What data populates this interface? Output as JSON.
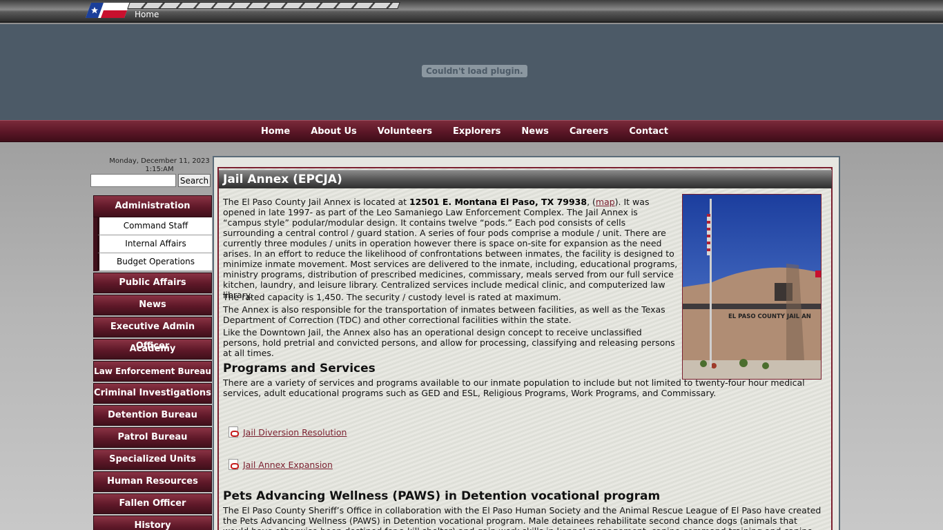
{
  "top_bar": {
    "home_label": "Home"
  },
  "plugin": {
    "message": "Couldn't load plugin."
  },
  "main_nav": [
    "Home",
    "About Us",
    "Volunteers",
    "Explorers",
    "News",
    "Careers",
    "Contact"
  ],
  "sidebar": {
    "date": "Monday, December 11, 2023",
    "time": "1:15:AM",
    "search_placeholder": "",
    "search_button": "Search",
    "active_section": "Administration",
    "sub_items": [
      "Command Staff",
      "Internal Affairs",
      "Budget Operations"
    ],
    "items": [
      "Public Affairs",
      "News",
      "Executive Admin Officer",
      "Academy",
      "Law Enforcement Bureau",
      "Criminal Investigations",
      "Detention Bureau",
      "Patrol Bureau",
      "Specialized Units",
      "Human Resources",
      "Fallen Officer",
      "History"
    ]
  },
  "content": {
    "title": "Jail Annex (EPCJA)",
    "p1_prefix": "The El Paso County Jail Annex is located at ",
    "p1_address": "12501 E. Montana El Paso, TX 79938",
    "p1_map_open": ", (",
    "p1_map": "map",
    "p1_rest": "). It was opened in late 1997- as part of the Leo Samaniego Law Enforcement Complex. The Jail Annex is “campus style” podular/modular design. It contains twelve “pods.” Each pod consists of cells surrounding a central control / guard station. A series of four pods comprise a module / unit. There are currently three modules / units in operation however there is space on-site for expansion as the need arises. In an effort to reduce the likelihood of confrontations between inmates, the facility is designed to minimize inmate movement. Most services are delivered to the inmate, including, educational programs, ministry programs, distribution of prescribed medicines, commissary, meals served from our full service kitchen, laundry, and leisure library. Centralized services include medical clinic, and computerized law library.",
    "p2": "The rated capacity is 1,450. The security / custody level is rated at maximum.",
    "p3": "The Annex is also responsible for the transportation of inmates between facilities, as well as the Texas Department of Correction (TDC) and other correctional facilities within the state.",
    "p4": "Like the Downtown Jail, the Annex also has an operational design concept to receive unclassified persons, hold pretrial and convicted persons, and allow for processing, classifying and releasing persons at all times.",
    "programs_heading": "Programs and Services",
    "programs_text": "There are a variety of services and programs available to our inmate population to include but not limited to twenty-four hour medical services, adult educational programs such as GED and ESL, Religious Programs, Work Programs, and Commissary.",
    "pdf1": "Jail Diversion Resolution",
    "pdf2": "Jail Annex Expansion",
    "paws_heading": "Pets Advancing Wellness (PAWS) in Detention vocational program",
    "paws_text": "The El Paso County Sheriff’s Office in collaboration with the El Paso Human Society and the Animal Rescue League of El Paso have created the Pets Advancing Wellness (PAWS) in Detention vocational program. Male detainees rehabilitate second chance dogs (animals that would have otherwise been destined for a kill shelter) and gain work skills in kennel management, canine command training and canine care. This",
    "photo_sign": "EL PASO COUNTY JAIL AN"
  },
  "colors": {
    "maroon": "#5e1828",
    "plugin_bg": "#4c5a67",
    "link": "#7a1e2e"
  }
}
